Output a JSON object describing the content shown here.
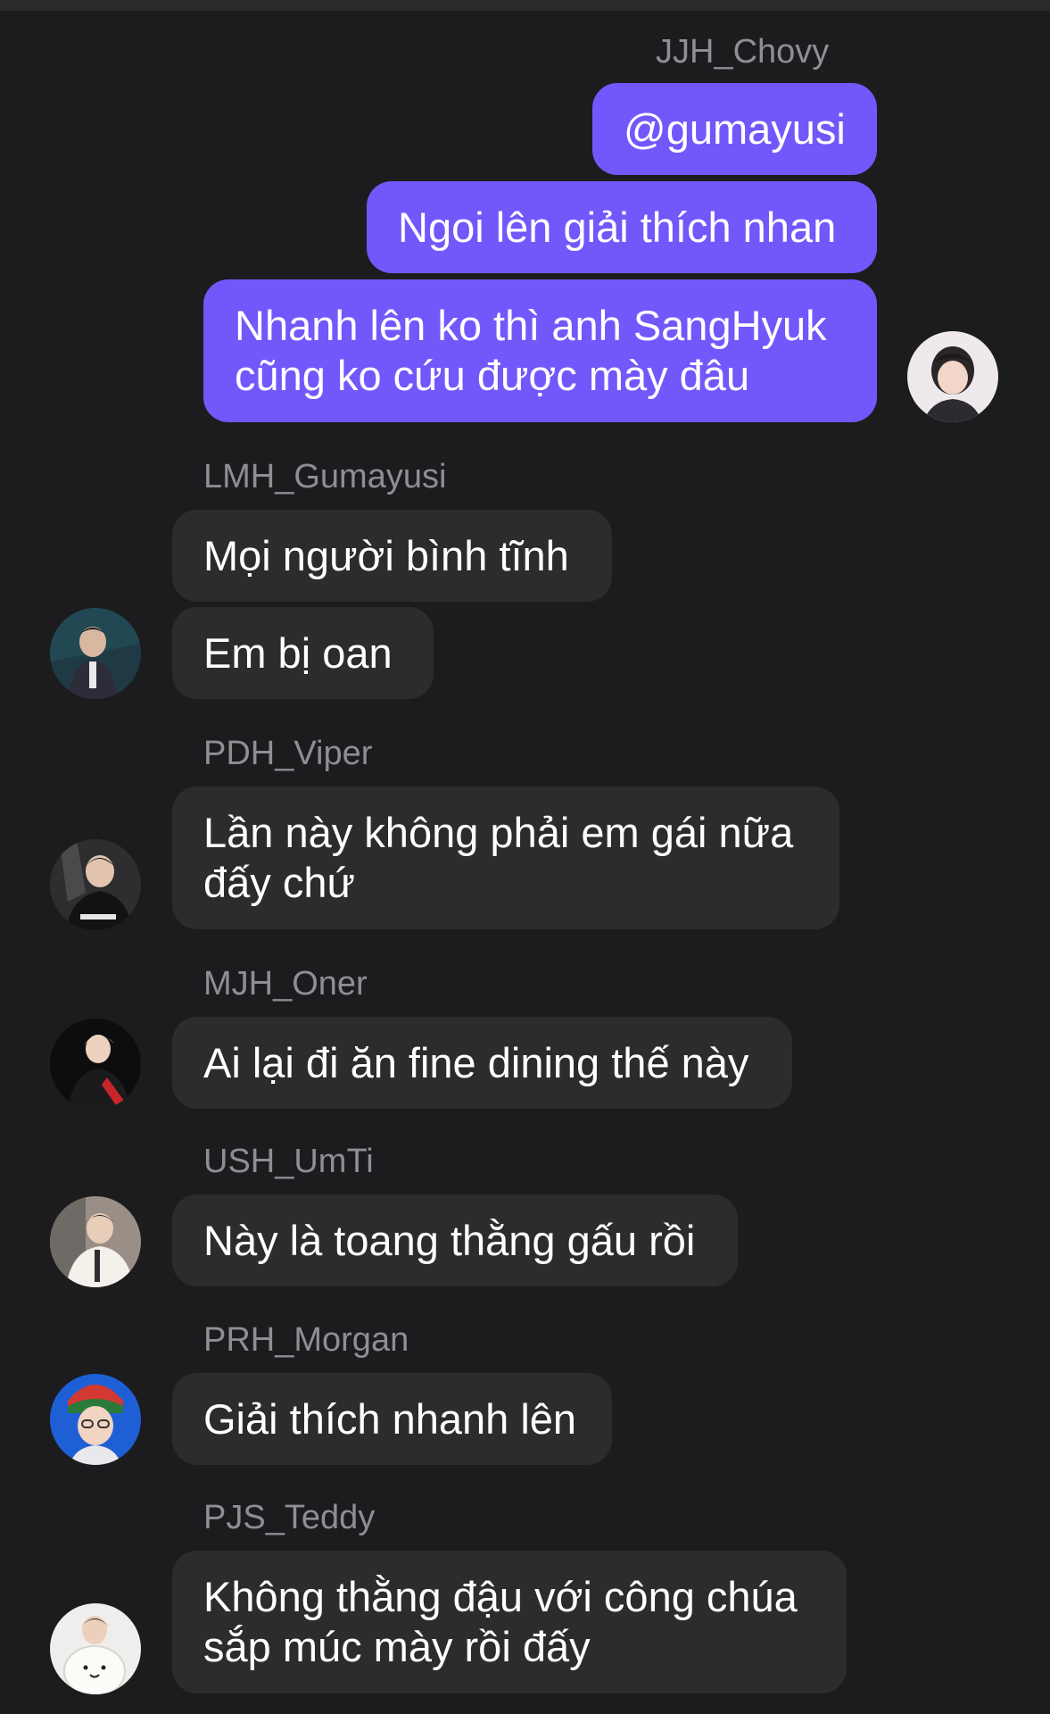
{
  "chat": {
    "outgoing": {
      "sender": "JJH_Chovy",
      "messages": [
        "@gumayusi",
        "Ngoi lên giải thích nhan",
        "Nhanh lên ko thì anh SangHyuk\ncũng ko cứu được mày đâu"
      ],
      "bubble_color": "#7357fb"
    },
    "incoming": [
      {
        "sender": "LMH_Gumayusi",
        "messages": [
          "Mọi người bình tĩnh",
          "Em bị oan"
        ]
      },
      {
        "sender": "PDH_Viper",
        "messages": [
          "Lần này không phải em gái nữa\nđấy chứ"
        ]
      },
      {
        "sender": "MJH_Oner",
        "messages": [
          "Ai lại đi ăn fine dining thế này"
        ]
      },
      {
        "sender": "USH_UmTi",
        "messages": [
          "Này là toang thằng gấu rồi"
        ]
      },
      {
        "sender": "PRH_Morgan",
        "messages": [
          "Giải thích nhanh lên"
        ]
      },
      {
        "sender": "PJS_Teddy",
        "messages": [
          "Không thằng đậu với công chúa\nsắp múc mày rồi đấy"
        ]
      }
    ],
    "colors": {
      "background": "#1c1c1e",
      "incoming_bubble": "#2c2c2e",
      "sender_name": "#8e8e93"
    }
  }
}
